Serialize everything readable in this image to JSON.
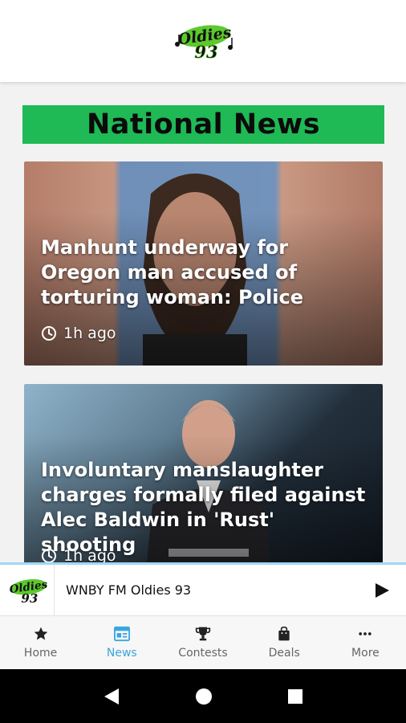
{
  "header": {
    "logo_alt": "Oldies 93 logo",
    "logo_word": "Oldies",
    "logo_num": "93"
  },
  "section": {
    "title": "National News"
  },
  "articles": [
    {
      "headline": "Manhunt underway for Oregon man accused of torturing woman: Police",
      "time": "1h ago"
    },
    {
      "headline": "Involuntary manslaughter charges formally filed against Alec Baldwin in 'Rust' shooting",
      "time": "1h ago"
    }
  ],
  "player": {
    "station": "WNBY FM Oldies 93"
  },
  "nav": {
    "items": [
      {
        "label": "Home",
        "icon": "star-icon"
      },
      {
        "label": "News",
        "icon": "news-icon"
      },
      {
        "label": "Contests",
        "icon": "trophy-icon"
      },
      {
        "label": "Deals",
        "icon": "bag-icon"
      },
      {
        "label": "More",
        "icon": "more-dots-icon"
      }
    ],
    "active": "News"
  },
  "colors": {
    "banner_green": "#1fb955",
    "accent_blue": "#3aa6df",
    "logo_green": "#5cc92d"
  }
}
